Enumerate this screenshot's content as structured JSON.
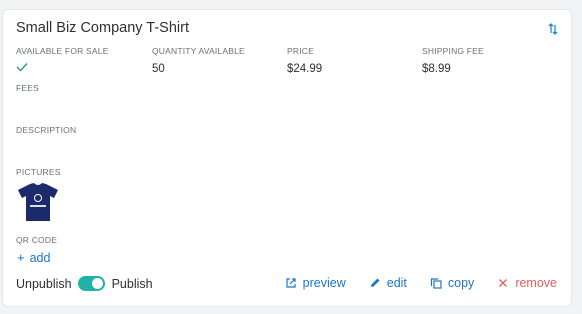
{
  "product": {
    "title": "Small Biz Company T-Shirt",
    "fields": {
      "available_for_sale_label": "AVAILABLE FOR SALE",
      "quantity_label": "QUANTITY AVAILABLE",
      "quantity_value": "50",
      "price_label": "PRICE",
      "price_value": "$24.99",
      "shipping_label": "SHIPPING FEE",
      "shipping_value": "$8.99",
      "fees_label": "FEES",
      "description_label": "DESCRIPTION",
      "pictures_label": "PICTURES",
      "qr_label": "QR CODE"
    },
    "qr_add_label": "add"
  },
  "footer": {
    "unpublish_label": "Unpublish",
    "publish_label": "Publish",
    "toggle_state": "publish"
  },
  "actions": {
    "preview": "preview",
    "edit": "edit",
    "copy": "copy",
    "remove": "remove"
  },
  "icons": {
    "sort": "sort-arrows-icon",
    "check": "check-icon",
    "preview": "external-link-icon",
    "edit": "pencil-icon",
    "copy": "copy-icon",
    "remove": "close-icon"
  },
  "colors": {
    "accent": "#1b76c8",
    "toggle": "#20b2a8",
    "check": "#2f9e57",
    "danger": "#e45b5b",
    "shirt": "#1b2a6b"
  }
}
